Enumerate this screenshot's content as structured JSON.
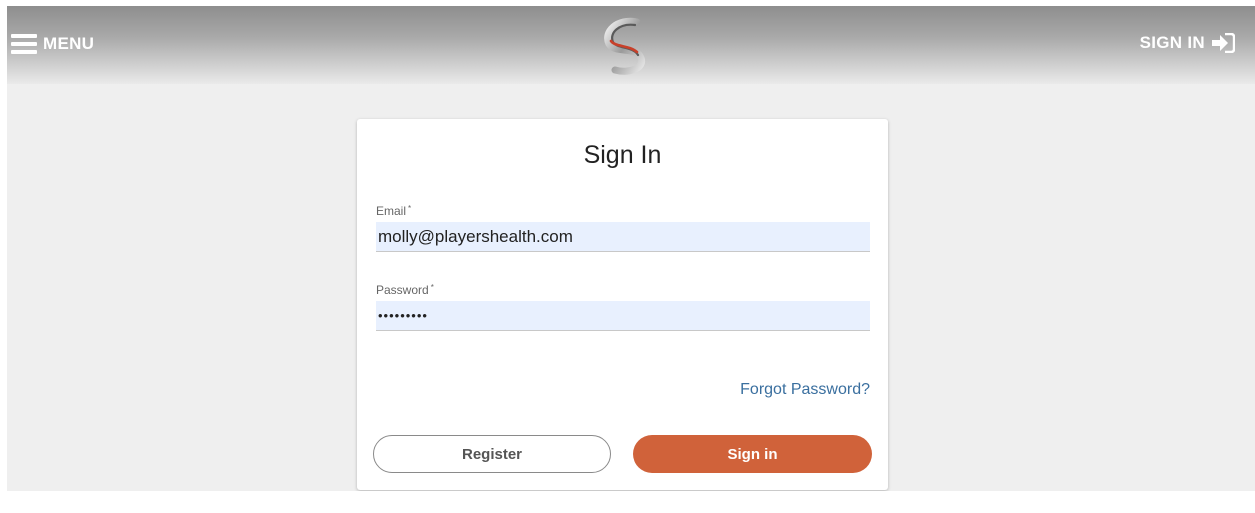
{
  "header": {
    "menu_label": "MENU",
    "signin_label": "SIGN IN",
    "icons": {
      "menu": "hamburger-icon",
      "logo": "brand-logo",
      "signin": "sign-in-arrow-icon"
    }
  },
  "form": {
    "title": "Sign In",
    "email": {
      "label": "Email",
      "required_mark": "*",
      "value": "molly@playershealth.com"
    },
    "password": {
      "label": "Password",
      "required_mark": "*",
      "value": "•••••••••"
    },
    "forgot_link": "Forgot Password?",
    "register_label": "Register",
    "signin_label": "Sign in"
  },
  "colors": {
    "accent": "#d0623a",
    "link": "#3a6f9f",
    "input_fill": "#e8f0fe",
    "page_background": "#efefef"
  }
}
